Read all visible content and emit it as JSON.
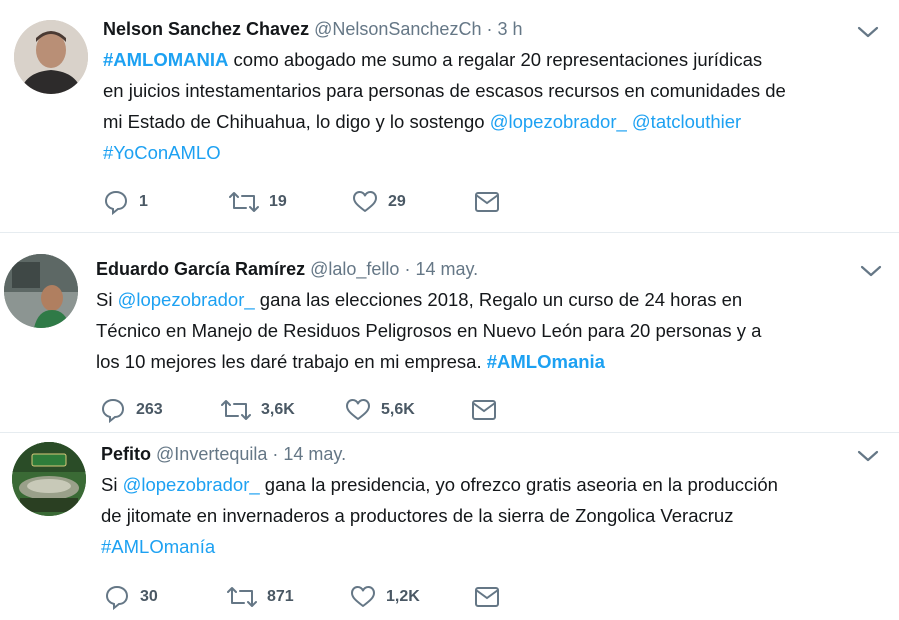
{
  "tweets": [
    {
      "name": "Nelson Sanchez Chavez",
      "handle": "@NelsonSanchezCh",
      "sep": "·",
      "time": "3 h",
      "lines": [
        [
          {
            "t": "#AMLOMANIA",
            "c": "link bold"
          },
          {
            "t": " como abogado me sumo a regalar 20 representaciones jurídicas",
            "c": ""
          }
        ],
        [
          {
            "t": "en juicios intestamentarios para personas de escasos recursos en comunidades de",
            "c": ""
          }
        ],
        [
          {
            "t": "mi Estado de Chihuahua, lo digo y lo sostengo ",
            "c": ""
          },
          {
            "t": "@lopezobrador_",
            "c": "link"
          },
          {
            "t": " ",
            "c": ""
          },
          {
            "t": "@tatclouthier",
            "c": "link"
          }
        ],
        [
          {
            "t": "#YoConAMLO",
            "c": "link"
          }
        ]
      ],
      "replies": "1",
      "retweets": "19",
      "likes": "29"
    },
    {
      "name": "Eduardo García Ramírez",
      "handle": "@lalo_fello",
      "sep": "·",
      "time": "14 may.",
      "lines": [
        [
          {
            "t": "Si ",
            "c": ""
          },
          {
            "t": "@lopezobrador_",
            "c": "link"
          },
          {
            "t": " gana las elecciones 2018, Regalo un curso de 24 horas en",
            "c": ""
          }
        ],
        [
          {
            "t": "Técnico en Manejo de Residuos Peligrosos en Nuevo León para 20 personas y a",
            "c": ""
          }
        ],
        [
          {
            "t": "los 10 mejores les daré trabajo en mi empresa. ",
            "c": ""
          },
          {
            "t": "#AMLOmania",
            "c": "link bold"
          }
        ]
      ],
      "replies": "263",
      "retweets": "3,6K",
      "likes": "5,6K"
    },
    {
      "name": "Pefito",
      "handle": "@Invertequila",
      "sep": "·",
      "time": "14 may.",
      "lines": [
        [
          {
            "t": "Si ",
            "c": ""
          },
          {
            "t": "@lopezobrador_",
            "c": "link"
          },
          {
            "t": " gana la presidencia, yo ofrezco gratis aseoria en la producción",
            "c": ""
          }
        ],
        [
          {
            "t": "de jitomate en invernaderos a productores de la sierra de Zongolica Veracruz",
            "c": ""
          }
        ],
        [
          {
            "t": "#AMLOmanía",
            "c": "link"
          }
        ]
      ],
      "replies": "30",
      "retweets": "871",
      "likes": "1,2K"
    }
  ],
  "colors": {
    "link": "#1da1f2",
    "text": "#14171a",
    "meta": "#657786",
    "icon": "#657786",
    "separator": "#e6ecf0"
  },
  "icons": [
    "user-avatar",
    "chevron-down-icon",
    "reply-icon",
    "retweet-icon",
    "like-icon",
    "direct-message-icon"
  ]
}
